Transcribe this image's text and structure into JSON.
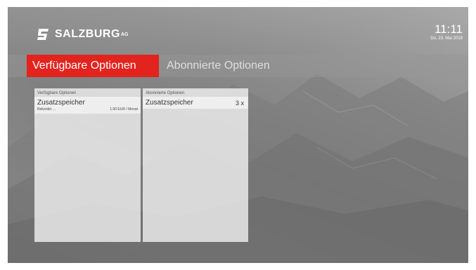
{
  "header": {
    "brand": "SALZBURG",
    "brand_suffix": "AG",
    "time": "11:11",
    "date": "Do, 23. Mai 2019"
  },
  "tabs": [
    {
      "label": "Verfügbare Optionen",
      "active": true
    },
    {
      "label": "Abonnierte Optionen",
      "active": false
    }
  ],
  "panels": {
    "available": {
      "header": "Verfügbare Optionen",
      "items": [
        {
          "title": "Zusatzspeicher",
          "subtitle": "Rekorder ...",
          "price": "1,90 EUR / Monat"
        }
      ]
    },
    "subscribed": {
      "header": "Abonnierte Optionen",
      "items": [
        {
          "title": "Zusatzspeicher",
          "quantity": "3 x"
        }
      ]
    }
  },
  "colors": {
    "accent": "#e3231d",
    "background": "#8d8d8d"
  }
}
